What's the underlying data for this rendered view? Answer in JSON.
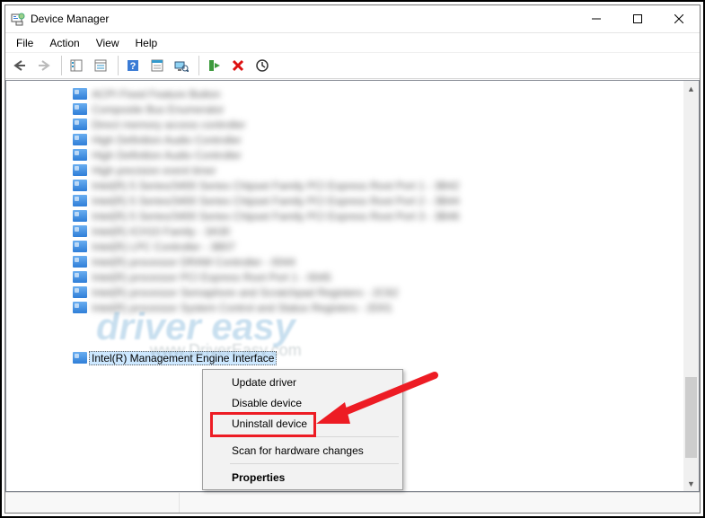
{
  "window": {
    "title": "Device Manager"
  },
  "menubar": {
    "file": "File",
    "action": "Action",
    "view": "View",
    "help": "Help"
  },
  "tree": {
    "blur_items": [
      "ACPI Fixed Feature Button",
      "Composite Bus Enumerator",
      "Direct memory access controller",
      "High Definition Audio Controller",
      "High Definition Audio Controller",
      "High precision event timer",
      "Intel(R) 5 Series/3400 Series Chipset Family PCI Express Root Port 1 - 3B42",
      "Intel(R) 5 Series/3400 Series Chipset Family PCI Express Root Port 2 - 3B44",
      "Intel(R) 5 Series/3400 Series Chipset Family PCI Express Root Port 3 - 3B46",
      "Intel(R) ICH10 Family - 3A30",
      "Intel(R) LPC Controller - 3B07",
      "Intel(R) processor DRAM Controller - 0044",
      "Intel(R) processor PCI Express Root Port 1 - 0045",
      "Intel(R) processor Semaphore and Scratchpad Registers - 2C62",
      "Intel(R) processor System Control and Status Registers - 2D01"
    ],
    "selected": "Intel(R) Management Engine Interface"
  },
  "context_menu": {
    "update": "Update driver",
    "disable": "Disable device",
    "uninstall": "Uninstall device",
    "scan": "Scan for hardware changes",
    "properties": "Properties"
  },
  "watermark": {
    "main": "driver easy",
    "sub": "www.DriverEasy.com"
  }
}
